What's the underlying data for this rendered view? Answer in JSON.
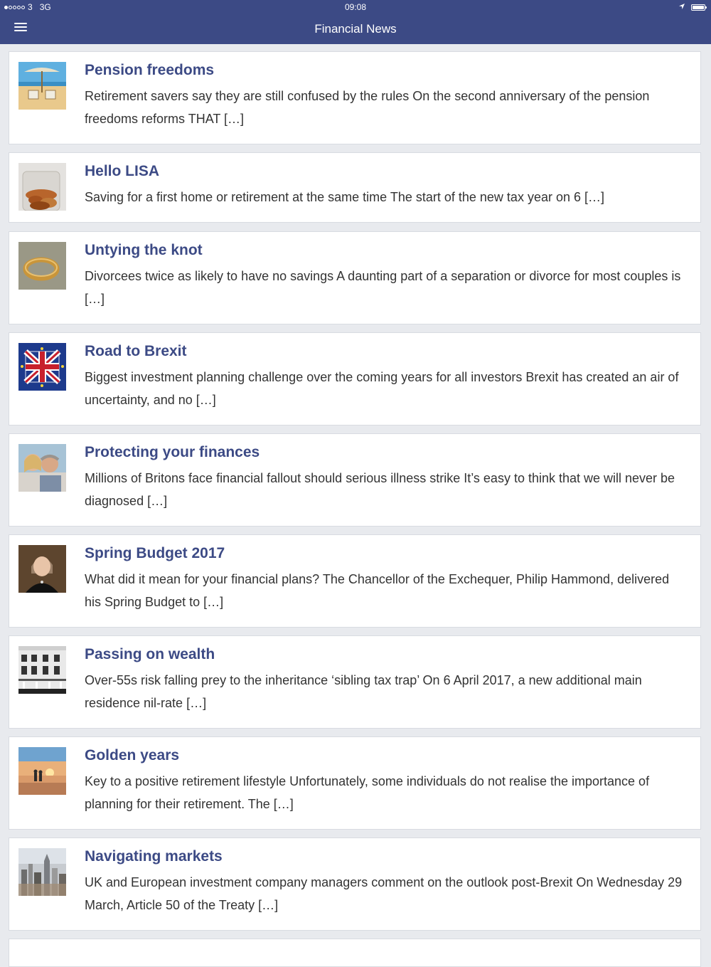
{
  "status_bar": {
    "carrier": "3",
    "network": "3G",
    "time": "09:08"
  },
  "header": {
    "title": "Financial News",
    "menu_icon": "hamburger-menu-icon"
  },
  "articles": [
    {
      "title": "Pension freedoms",
      "excerpt": "Retirement savers say they are still confused by the rules On the second anniversary of the pension freedoms reforms THAT […]",
      "thumbnail": "beach-chairs-image"
    },
    {
      "title": "Hello LISA",
      "excerpt": "Saving for a first home or retirement at the same time The start of the new tax year on 6 […]",
      "thumbnail": "coin-jar-image"
    },
    {
      "title": "Untying the knot",
      "excerpt": "Divorcees twice as likely to have no savings A daunting part of a separation or divorce for most couples is […]",
      "thumbnail": "wedding-ring-image"
    },
    {
      "title": "Road to Brexit",
      "excerpt": "Biggest investment planning challenge over the coming years for all investors Brexit has created an air of uncertainty, and no […]",
      "thumbnail": "union-jack-eu-puzzle-image"
    },
    {
      "title": "Protecting your finances",
      "excerpt": "Millions of Britons face financial fallout should serious illness strike It’s easy to think that we will never be diagnosed […]",
      "thumbnail": "smiling-couple-image"
    },
    {
      "title": "Spring Budget 2017",
      "excerpt": "What did it mean for your financial plans? The Chancellor of the Exchequer, Philip Hammond, delivered his Spring Budget to […]",
      "thumbnail": "woman-portrait-image"
    },
    {
      "title": "Passing on wealth",
      "excerpt": "Over-55s risk falling prey to the inheritance ‘sibling tax trap’ On 6 April 2017, a new additional main residence nil-rate […]",
      "thumbnail": "townhouses-image"
    },
    {
      "title": "Golden years",
      "excerpt": "Key to a positive retirement lifestyle Unfortunately, some individuals do not realise the importance of planning for their retirement. The […]",
      "thumbnail": "sunset-couple-image"
    },
    {
      "title": "Navigating markets",
      "excerpt": "UK and European investment company managers comment on the outlook post-Brexit On Wednesday 29 March, Article 50 of the Treaty […]",
      "thumbnail": "city-skyline-image"
    }
  ]
}
